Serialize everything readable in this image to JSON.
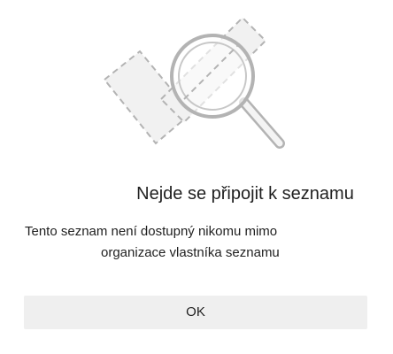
{
  "dialog": {
    "title": "Nejde se připojit k seznamu",
    "message_line1": "Tento seznam není dostupný nikomu mimo",
    "message_line2": "organizace vlastníka seznamu",
    "ok_label": "OK"
  },
  "illustration": {
    "icon": "magnifier-search-icon",
    "colors": {
      "stroke": "#b3b3b3",
      "fill": "#f1f1f1",
      "lens": "#ffffff"
    }
  }
}
